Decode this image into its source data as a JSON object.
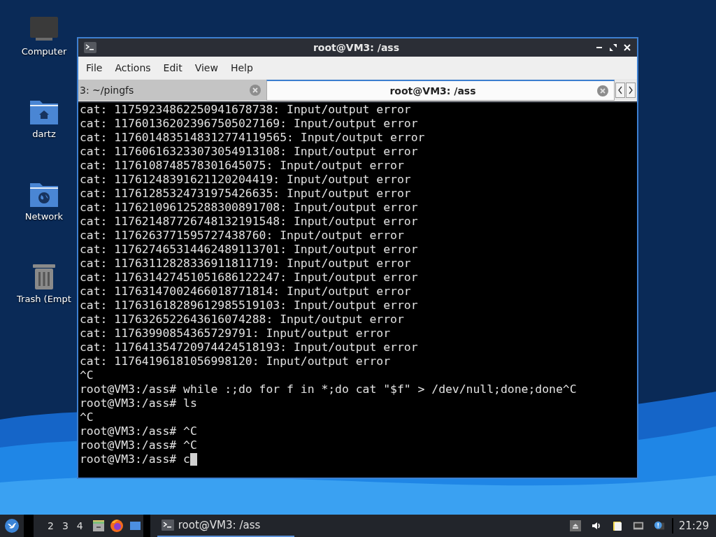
{
  "desktop": {
    "icons": [
      {
        "label": "Computer",
        "kind": "computer"
      },
      {
        "label": "dartz",
        "kind": "home"
      },
      {
        "label": "Network",
        "kind": "network"
      },
      {
        "label": "Trash (Empt",
        "kind": "trash"
      }
    ]
  },
  "window": {
    "title": "root@VM3: /ass",
    "menu": [
      "File",
      "Actions",
      "Edit",
      "View",
      "Help"
    ],
    "tabs": [
      {
        "label": "3: ~/pingfs",
        "selected": false
      },
      {
        "label": "root@VM3: /ass",
        "selected": true
      }
    ],
    "terminal": {
      "lines": [
        "cat: 11759234862250941678738: Input/output error",
        "cat: 117601362023967505027169: Input/output error",
        "cat: 1176014835148312774119565: Input/output error",
        "cat: 117606163233073054913108: Input/output error",
        "cat: 1176108748578301645075: Input/output error",
        "cat: 11761248391621120204419: Input/output error",
        "cat: 11761285324731975426635: Input/output error",
        "cat: 117621096125288300891708: Input/output error",
        "cat: 117621487726748132191548: Input/output error",
        "cat: 1176263771595727438760: Input/output error",
        "cat: 117627465314462489113701: Input/output error",
        "cat: 11763112828336911811719: Input/output error",
        "cat: 117631427451051686122247: Input/output error",
        "cat: 11763147002466018771814: Input/output error",
        "cat: 117631618289612985519103: Input/output error",
        "cat: 1176326522643616074288: Input/output error",
        "cat: 11763990854365729791: Input/output error",
        "cat: 117641354720974424518193: Input/output error",
        "cat: 11764196181056998120: Input/output error",
        "^C",
        "root@VM3:/ass# while :;do for f in *;do cat \"$f\" > /dev/null;done;done^C",
        "root@VM3:/ass# ls",
        "^C",
        "root@VM3:/ass# ^C",
        "root@VM3:/ass# ^C",
        "root@VM3:/ass# c"
      ]
    }
  },
  "taskbar": {
    "workspaces": [
      "2",
      "3",
      "4"
    ],
    "tasks": [
      {
        "label": "root@VM3: /ass",
        "selected": true
      }
    ],
    "clock": "21:29"
  }
}
